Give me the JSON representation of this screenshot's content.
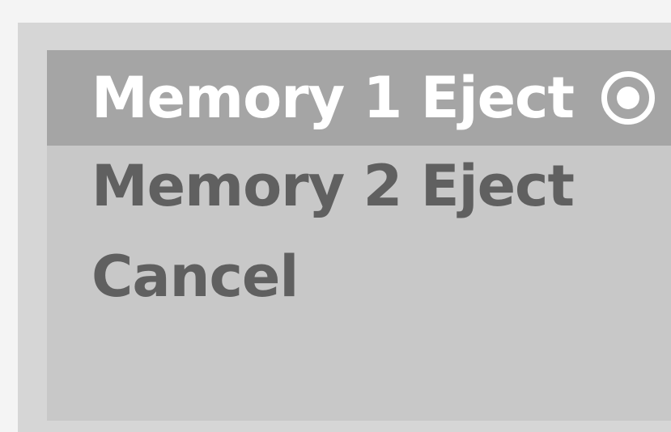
{
  "menu": {
    "items": [
      {
        "label": "Memory 1 Eject",
        "selected": true,
        "icon": "radio-selected-icon"
      },
      {
        "label": "Memory 2 Eject",
        "selected": false
      },
      {
        "label": "Cancel",
        "selected": false
      }
    ]
  },
  "colors": {
    "panel_bg": "#d6d6d6",
    "menu_bg": "#c8c8c8",
    "highlight_bg": "#a5a5a5",
    "selected_text": "#ffffff",
    "text": "#606060"
  }
}
